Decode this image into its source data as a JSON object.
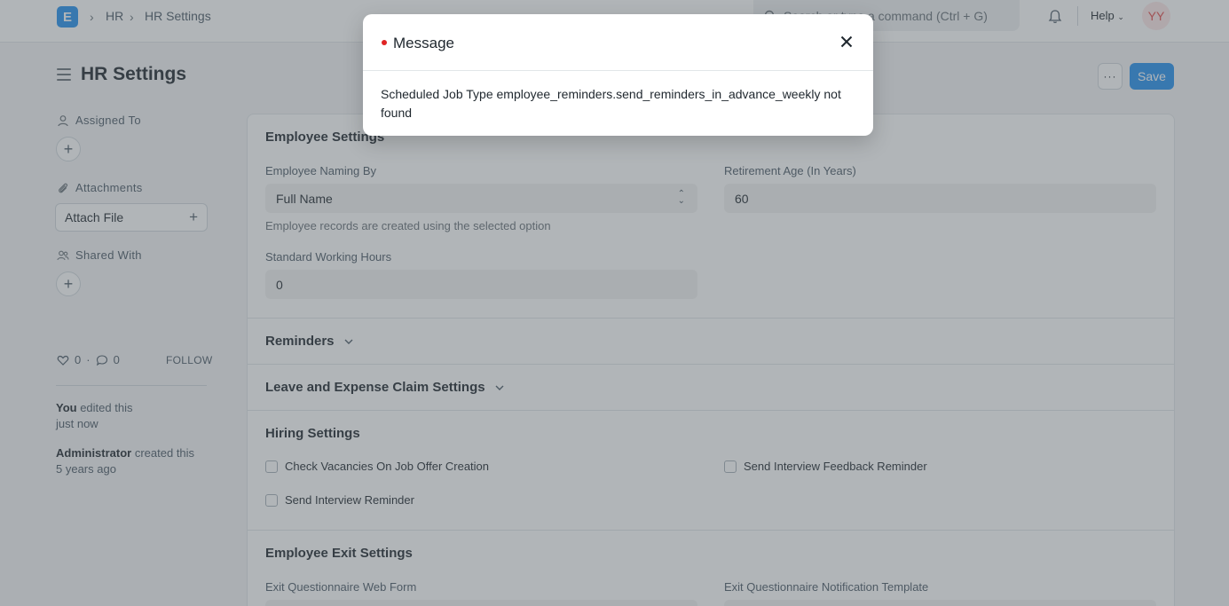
{
  "navbar": {
    "logo_letter": "E",
    "breadcrumbs": [
      "HR",
      "HR Settings"
    ],
    "search_placeholder": "Search or type a command (Ctrl + G)",
    "help_label": "Help",
    "avatar_initials": "YY"
  },
  "page": {
    "title": "HR Settings",
    "more_label": "···",
    "save_label": "Save"
  },
  "sidebar": {
    "assigned_to": "Assigned To",
    "attachments": "Attachments",
    "attach_file": "Attach File",
    "shared_with": "Shared With",
    "likes": "0",
    "comments": "0",
    "dot": "·",
    "follow": "FOLLOW",
    "timeline": [
      {
        "actor": "You",
        "action": " edited this",
        "when": "just now"
      },
      {
        "actor": "Administrator",
        "action": " created this",
        "when": "5 years ago"
      }
    ]
  },
  "form": {
    "employee_settings": {
      "title": "Employee Settings",
      "naming_label": "Employee Naming By",
      "naming_value": "Full Name",
      "naming_help": "Employee records are created using the selected option",
      "retirement_label": "Retirement Age (In Years)",
      "retirement_value": "60",
      "working_hours_label": "Standard Working Hours",
      "working_hours_value": "0"
    },
    "reminders": {
      "title": "Reminders"
    },
    "leave_expense": {
      "title": "Leave and Expense Claim Settings"
    },
    "hiring": {
      "title": "Hiring Settings",
      "check_vacancies": "Check Vacancies On Job Offer Creation",
      "send_interview_reminder": "Send Interview Reminder",
      "send_feedback_reminder": "Send Interview Feedback Reminder"
    },
    "exit": {
      "title": "Employee Exit Settings",
      "questionnaire_form_label": "Exit Questionnaire Web Form",
      "notification_template_label": "Exit Questionnaire Notification Template"
    }
  },
  "modal": {
    "title": "Message",
    "indicator_color": "#e02424",
    "body": "Scheduled Job Type employee_reminders.send_reminders_in_advance_weekly not found"
  }
}
